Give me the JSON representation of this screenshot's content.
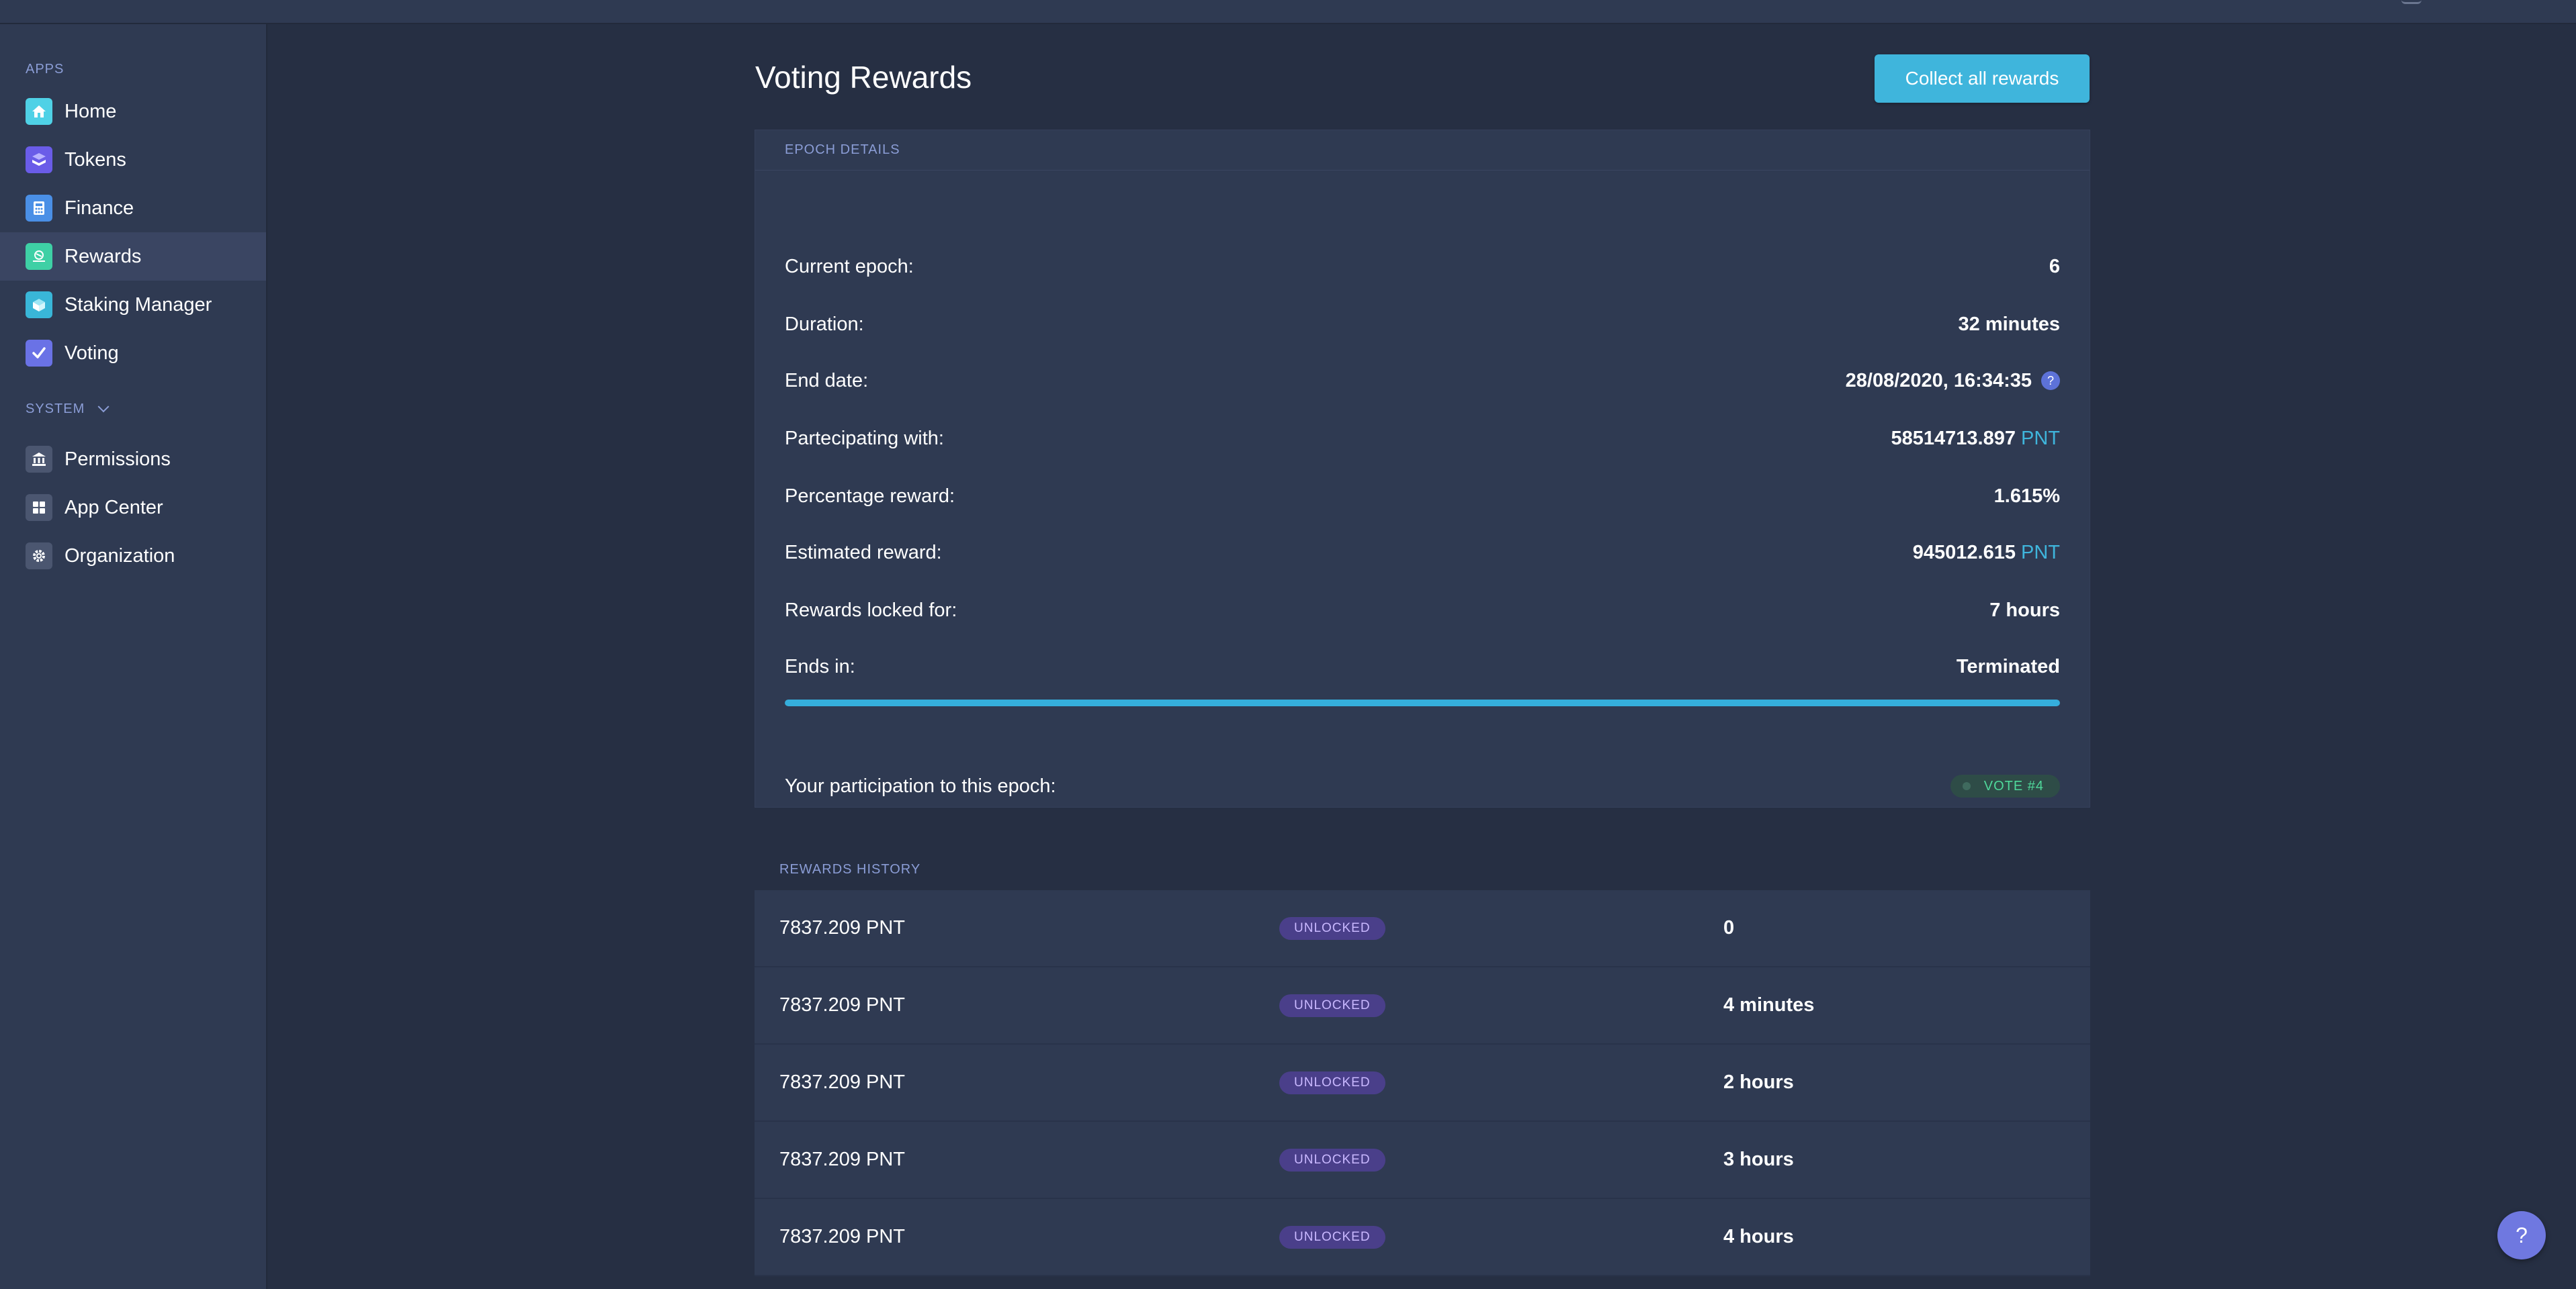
{
  "sidebar": {
    "apps_label": "APPS",
    "system_label": "SYSTEM",
    "apps": [
      {
        "label": "Home",
        "icon": "home-icon",
        "color": "#4fd1e6"
      },
      {
        "label": "Tokens",
        "icon": "tokens-icon",
        "color": "#6a5ce8"
      },
      {
        "label": "Finance",
        "icon": "calculator-icon",
        "color": "#4a8fe6"
      },
      {
        "label": "Rewards",
        "icon": "rewards-icon",
        "color": "#3ed0a5",
        "active": true
      },
      {
        "label": "Staking Manager",
        "icon": "cube-icon",
        "color": "#39b6d8"
      },
      {
        "label": "Voting",
        "icon": "checkmark-icon",
        "color": "#6a72e6"
      }
    ],
    "system": [
      {
        "label": "Permissions",
        "icon": "bank-icon",
        "color": "#4b5670"
      },
      {
        "label": "App Center",
        "icon": "grid-icon",
        "color": "#4b5670"
      },
      {
        "label": "Organization",
        "icon": "gear-icon",
        "color": "#4b5670"
      }
    ]
  },
  "header": {
    "title": "Voting Rewards",
    "collect_button": "Collect all rewards"
  },
  "epoch": {
    "header": "EPOCH DETAILS",
    "rows": [
      {
        "label": "Current epoch:",
        "value": "6"
      },
      {
        "label": "Duration:",
        "value": "32 minutes"
      },
      {
        "label": "End date:",
        "value": "28/08/2020, 16:34:35",
        "help": "?"
      },
      {
        "label": "Partecipating with:",
        "value": "58514713.897",
        "unit": "PNT"
      },
      {
        "label": "Percentage reward:",
        "value": "1.615%"
      },
      {
        "label": "Estimated reward:",
        "value": "945012.615",
        "unit": "PNT"
      },
      {
        "label": "Rewards locked for:",
        "value": "7 hours"
      },
      {
        "label": "Ends in:",
        "value": "Terminated"
      }
    ],
    "progress": 1.0,
    "participation_label": "Your participation to this epoch:",
    "participation_badge": "VOTE #4"
  },
  "history": {
    "header": "REWARDS HISTORY",
    "rows": [
      {
        "amount": "7837.209 PNT",
        "status": "UNLOCKED",
        "time": "0"
      },
      {
        "amount": "7837.209 PNT",
        "status": "UNLOCKED",
        "time": "4 minutes"
      },
      {
        "amount": "7837.209 PNT",
        "status": "UNLOCKED",
        "time": "2 hours"
      },
      {
        "amount": "7837.209 PNT",
        "status": "UNLOCKED",
        "time": "3 hours"
      },
      {
        "amount": "7837.209 PNT",
        "status": "UNLOCKED",
        "time": "4 hours"
      }
    ]
  },
  "help_button": "?"
}
